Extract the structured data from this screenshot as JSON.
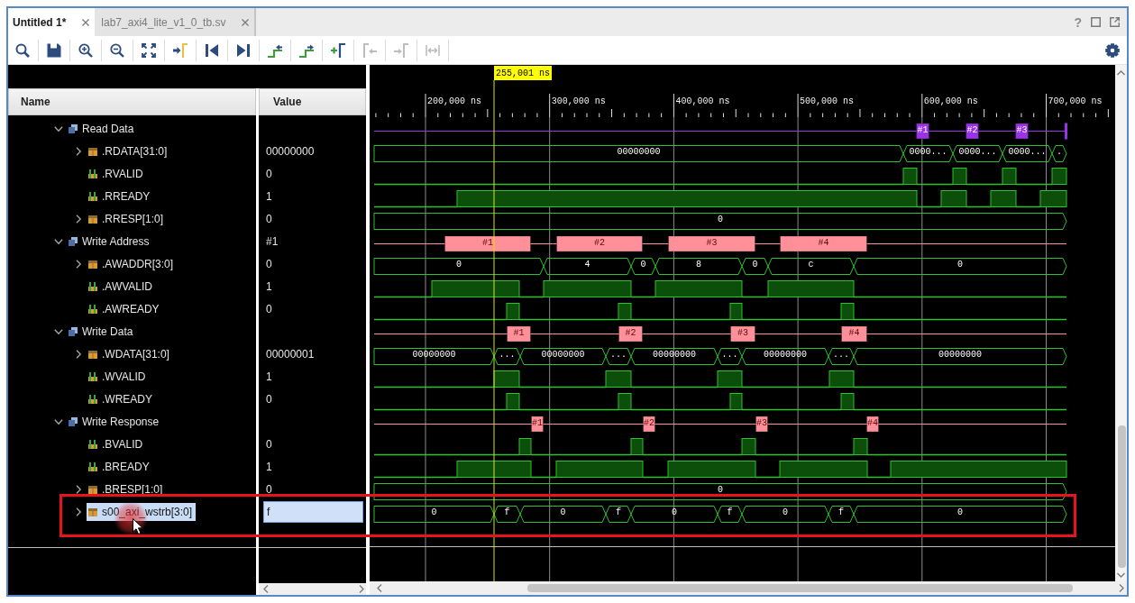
{
  "tabs": [
    {
      "label": "Untitled 1*",
      "selected": true
    },
    {
      "label": "lab7_axi4_lite_v1_0_tb.sv",
      "selected": false
    }
  ],
  "window_controls": {
    "help": "?"
  },
  "toolbar": [
    {
      "kind": "search",
      "disabled": false
    },
    {
      "kind": "save",
      "disabled": false
    },
    {
      "kind": "zoom-in",
      "disabled": false
    },
    {
      "kind": "zoom-out",
      "disabled": false
    },
    {
      "kind": "zoom-fit",
      "disabled": false
    },
    {
      "kind": "go-to-cursor",
      "disabled": false
    },
    {
      "kind": "go-to-start",
      "disabled": false
    },
    {
      "kind": "go-to-end",
      "disabled": false
    },
    {
      "kind": "previous-transition",
      "disabled": false
    },
    {
      "kind": "next-transition",
      "disabled": false
    },
    {
      "kind": "add-marker",
      "disabled": false
    },
    {
      "kind": "previous-marker",
      "disabled": true
    },
    {
      "kind": "next-marker",
      "disabled": true
    },
    {
      "kind": "swap-cursors",
      "disabled": true
    }
  ],
  "columns": {
    "name": "Name",
    "value": "Value"
  },
  "cursor": {
    "time": "255,001 ns"
  },
  "time_axis": {
    "ticks": [
      "200,000 ns",
      "300,000 ns",
      "400,000 ns",
      "500,000 ns",
      "600,000 ns",
      "700,000 ns"
    ]
  },
  "signals": [
    {
      "kind": "group",
      "label": "Read Data",
      "expanded": true,
      "selected": false,
      "color": "#9933e6",
      "transactions": [
        {
          "label": "#1"
        },
        {
          "label": "#2"
        },
        {
          "label": "#3"
        },
        {
          "cut": true
        }
      ],
      "children": [
        {
          "kind": "bus",
          "label": ".RDATA[31:0]",
          "expanded": false,
          "selected": false,
          "value": "00000000",
          "wave": [
            {
              "value": "00000000"
            },
            {
              "value": "0000..."
            },
            {
              "value": "0000..."
            },
            {
              "value": "0000..."
            },
            {
              "value": "."
            }
          ]
        },
        {
          "kind": "bit",
          "label": ".RVALID",
          "selected": false,
          "value": "0",
          "wave": [
            {
              "high": false
            },
            {
              "high": true
            },
            {
              "high": false
            },
            {
              "high": true
            },
            {
              "high": false
            },
            {
              "high": true
            },
            {
              "high": false
            },
            {
              "high": true
            }
          ]
        },
        {
          "kind": "bit",
          "label": ".RREADY",
          "selected": false,
          "value": "1",
          "wave": [
            {
              "high": false
            },
            {
              "high": true
            },
            {
              "high": false
            },
            {
              "high": true
            },
            {
              "high": false
            },
            {
              "high": true
            },
            {
              "high": false
            },
            {
              "high": true
            }
          ]
        },
        {
          "kind": "bus",
          "label": ".RRESP[1:0]",
          "expanded": false,
          "selected": false,
          "value": "0",
          "wave": [
            {
              "value": "0"
            }
          ]
        }
      ]
    },
    {
      "kind": "group",
      "label": "Write Address",
      "expanded": true,
      "selected": false,
      "value": "#1",
      "color": "#ff8f99",
      "transactions": [
        {
          "label": "#1"
        },
        {
          "label": "#2"
        },
        {
          "label": "#3"
        },
        {
          "label": "#4"
        }
      ],
      "children": [
        {
          "kind": "bus",
          "label": ".AWADDR[3:0]",
          "expanded": false,
          "selected": false,
          "value": "0",
          "wave": [
            {
              "value": "0"
            },
            {
              "value": "4"
            },
            {
              "value": "0"
            },
            {
              "value": "8"
            },
            {
              "value": "0"
            },
            {
              "value": "c"
            },
            {
              "value": "0"
            }
          ]
        },
        {
          "kind": "bit",
          "label": ".AWVALID",
          "selected": false,
          "value": "1",
          "wave": [
            {
              "high": false
            },
            {
              "high": true
            },
            {
              "high": false
            },
            {
              "high": true
            },
            {
              "high": false
            },
            {
              "high": true
            },
            {
              "high": false
            },
            {
              "high": true
            },
            {
              "high": false
            }
          ]
        },
        {
          "kind": "bit",
          "label": ".AWREADY",
          "selected": false,
          "value": "0",
          "wave": [
            {
              "high": false
            },
            {
              "high": true
            },
            {
              "high": false
            },
            {
              "high": true
            },
            {
              "high": false
            },
            {
              "high": true
            },
            {
              "high": false
            },
            {
              "high": true
            },
            {
              "high": false
            }
          ]
        }
      ]
    },
    {
      "kind": "group",
      "label": "Write Data",
      "expanded": true,
      "selected": false,
      "color": "#ff8f99",
      "transactions": [
        {
          "label": "#1"
        },
        {
          "label": "#2"
        },
        {
          "label": "#3"
        },
        {
          "label": "#4"
        }
      ],
      "children": [
        {
          "kind": "bus",
          "label": ".WDATA[31:0]",
          "expanded": false,
          "selected": false,
          "value": "00000001",
          "wave": [
            {
              "value": "00000000"
            },
            {
              "value": "..."
            },
            {
              "value": "00000000"
            },
            {
              "value": "..."
            },
            {
              "value": "00000000"
            },
            {
              "value": "..."
            },
            {
              "value": "00000000"
            },
            {
              "value": "..."
            },
            {
              "value": "00000000"
            }
          ]
        },
        {
          "kind": "bit",
          "label": ".WVALID",
          "selected": false,
          "value": "1",
          "wave": [
            {
              "high": false
            },
            {
              "high": true
            },
            {
              "high": false
            },
            {
              "high": true
            },
            {
              "high": false
            },
            {
              "high": true
            },
            {
              "high": false
            },
            {
              "high": true
            },
            {
              "high": false
            }
          ]
        },
        {
          "kind": "bit",
          "label": ".WREADY",
          "selected": false,
          "value": "0",
          "wave": [
            {
              "high": false
            },
            {
              "high": true
            },
            {
              "high": false
            },
            {
              "high": true
            },
            {
              "high": false
            },
            {
              "high": true
            },
            {
              "high": false
            },
            {
              "high": true
            },
            {
              "high": false
            }
          ]
        }
      ]
    },
    {
      "kind": "group",
      "label": "Write Response",
      "expanded": true,
      "selected": false,
      "color": "#ff8f99",
      "transactions": [
        {
          "label": "#1"
        },
        {
          "label": "#2"
        },
        {
          "label": "#3"
        },
        {
          "label": "#4"
        }
      ],
      "children": [
        {
          "kind": "bit",
          "label": ".BVALID",
          "selected": false,
          "value": "0",
          "wave": [
            {
              "high": false
            },
            {
              "high": true
            },
            {
              "high": false
            },
            {
              "high": true
            },
            {
              "high": false
            },
            {
              "high": true
            },
            {
              "high": false
            },
            {
              "high": true
            },
            {
              "high": false
            }
          ]
        },
        {
          "kind": "bit",
          "label": ".BREADY",
          "selected": false,
          "value": "1",
          "wave": [
            {
              "high": false
            },
            {
              "high": true
            },
            {
              "high": false
            },
            {
              "high": true
            },
            {
              "high": false
            },
            {
              "high": true
            },
            {
              "high": false
            },
            {
              "high": true
            },
            {
              "high": false
            },
            {
              "high": true
            }
          ]
        },
        {
          "kind": "bus",
          "label": ".BRESP[1:0]",
          "expanded": false,
          "selected": false,
          "value": "0",
          "wave": [
            {
              "value": "0"
            }
          ]
        }
      ]
    },
    {
      "kind": "bus",
      "label": "s00_axi_wstrb[3:0]",
      "expanded": false,
      "selected": true,
      "value": "f",
      "wave": [
        {
          "value": "0"
        },
        {
          "value": "f"
        },
        {
          "value": "0"
        },
        {
          "value": "f"
        },
        {
          "value": "0"
        },
        {
          "value": "f"
        },
        {
          "value": "0"
        },
        {
          "value": "f"
        },
        {
          "value": "0"
        }
      ]
    }
  ]
}
